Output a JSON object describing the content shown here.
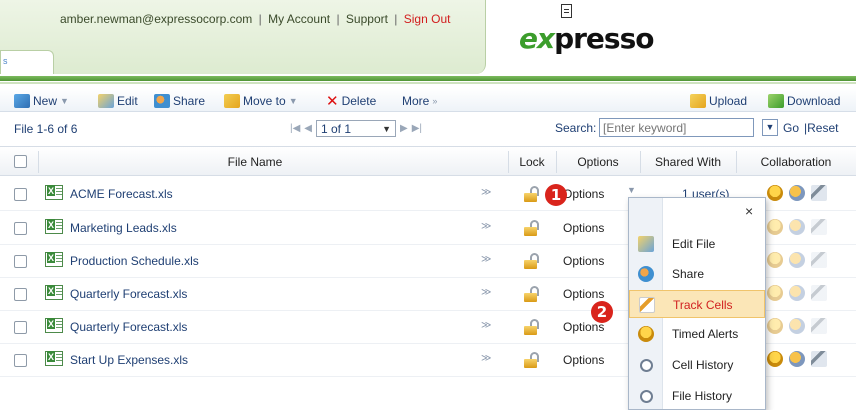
{
  "header": {
    "account_email": "amber.newman@expressocorp.com",
    "my_account": "My Account",
    "support": "Support",
    "sign_out": "Sign Out",
    "left_tab_mark": "s",
    "logo_prefix": "ex",
    "logo_suffix": "presso"
  },
  "toolbar": {
    "new": "New",
    "edit": "Edit",
    "share": "Share",
    "move_to": "Move to",
    "delete": "Delete",
    "more": "More",
    "upload": "Upload",
    "download": "Download"
  },
  "pager": {
    "count": "File 1-6 of 6",
    "page": "1 of 1",
    "search_label": "Search:",
    "search_placeholder": "[Enter keyword]",
    "go": "Go",
    "reset": "|Reset"
  },
  "table": {
    "columns": {
      "file_name": "File Name",
      "lock": "Lock",
      "options": "Options",
      "shared_with": "Shared With",
      "collaboration": "Collaboration"
    },
    "rows": [
      {
        "name": "ACME Forecast.xls",
        "options": "Options",
        "shared": "1 user(s)"
      },
      {
        "name": "Marketing Leads.xls",
        "options": "Options"
      },
      {
        "name": "Production Schedule.xls",
        "options": "Options"
      },
      {
        "name": "Quarterly Forecast.xls",
        "options": "Options"
      },
      {
        "name": "Quarterly Forecast.xls",
        "options": "Options"
      },
      {
        "name": "Start Up Expenses.xls",
        "options": "Options"
      }
    ]
  },
  "menu": {
    "close": "×",
    "items": [
      {
        "label": "Edit File",
        "icon": "edit-icon"
      },
      {
        "label": "Share",
        "icon": "share-icon"
      },
      {
        "label": "Track Cells",
        "icon": "track-cells-icon",
        "active": true
      },
      {
        "label": "Timed Alerts",
        "icon": "bell-icon"
      },
      {
        "label": "Cell History",
        "icon": "clock-icon"
      },
      {
        "label": "File History",
        "icon": "clock-icon"
      }
    ]
  },
  "callouts": {
    "one": "1",
    "two": "2"
  },
  "colors": {
    "accent_green": "#3c9d2c",
    "link_blue": "#1f3f73",
    "sign_out_red": "#d21d1d",
    "highlight": "#fbe6b7"
  }
}
